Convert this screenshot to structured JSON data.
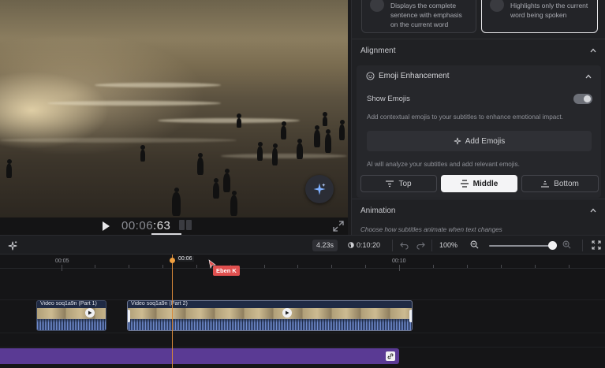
{
  "player": {
    "timecode_main": "00:06",
    "timecode_frames": ":63"
  },
  "panel": {
    "style_cards": [
      {
        "text": "Displays the complete sentence with emphasis on the current word"
      },
      {
        "text": "Highlights only the current word being spoken"
      }
    ],
    "alignment_label": "Alignment",
    "emoji": {
      "header": "Emoji Enhancement",
      "show_label": "Show Emojis",
      "description": "Add contextual emojis to your subtitles to enhance emotional impact.",
      "add_button": "Add Emojis",
      "ai_note": "AI will analyze your subtitles and add relevant emojis.",
      "positions": [
        "Top",
        "Middle",
        "Bottom"
      ],
      "selected_position": "Middle"
    },
    "animation_label": "Animation",
    "animation_desc": "Choose how subtitles animate when text changes"
  },
  "toolbar": {
    "duration": "4.23s",
    "total_time": "0:10:20",
    "zoom": "100%"
  },
  "timeline": {
    "ruler_labels": [
      "00:05",
      "00:10"
    ],
    "playhead_time": "00:06",
    "collaborator": "Eben K",
    "clips": [
      {
        "title": "Video soq1a9n (Part 1)"
      },
      {
        "title": "Video soq1a9n (Part 2)"
      }
    ]
  },
  "colors": {
    "accent_playhead": "#d9893a",
    "subtitle_track": "#5a3a94",
    "collaborator_tag": "#e0504f"
  }
}
